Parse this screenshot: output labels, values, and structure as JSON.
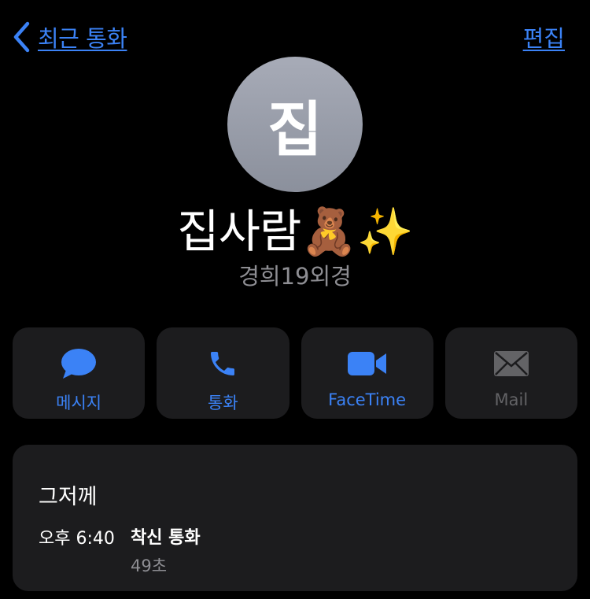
{
  "nav": {
    "back_label": "최근 통화",
    "edit_label": "편집",
    "back_icon": "chevron-left-icon"
  },
  "contact": {
    "avatar_initial": "집",
    "name": "집사람🧸✨",
    "subtitle": "경희19외경"
  },
  "actions": [
    {
      "label": "메시지",
      "icon": "message-bubble-icon",
      "enabled": true
    },
    {
      "label": "통화",
      "icon": "phone-icon",
      "enabled": true
    },
    {
      "label": "FaceTime",
      "icon": "video-camera-icon",
      "enabled": true
    },
    {
      "label": "Mail",
      "icon": "mail-envelope-icon",
      "enabled": false
    }
  ],
  "history": {
    "date": "그저께",
    "time": "오후 6:40",
    "type": "착신 통화",
    "duration": "49초"
  },
  "colors": {
    "background": "#000000",
    "accent": "#3b82f6",
    "card": "#1c1c1e",
    "secondary_text": "#8e8e93",
    "disabled": "#636366"
  }
}
